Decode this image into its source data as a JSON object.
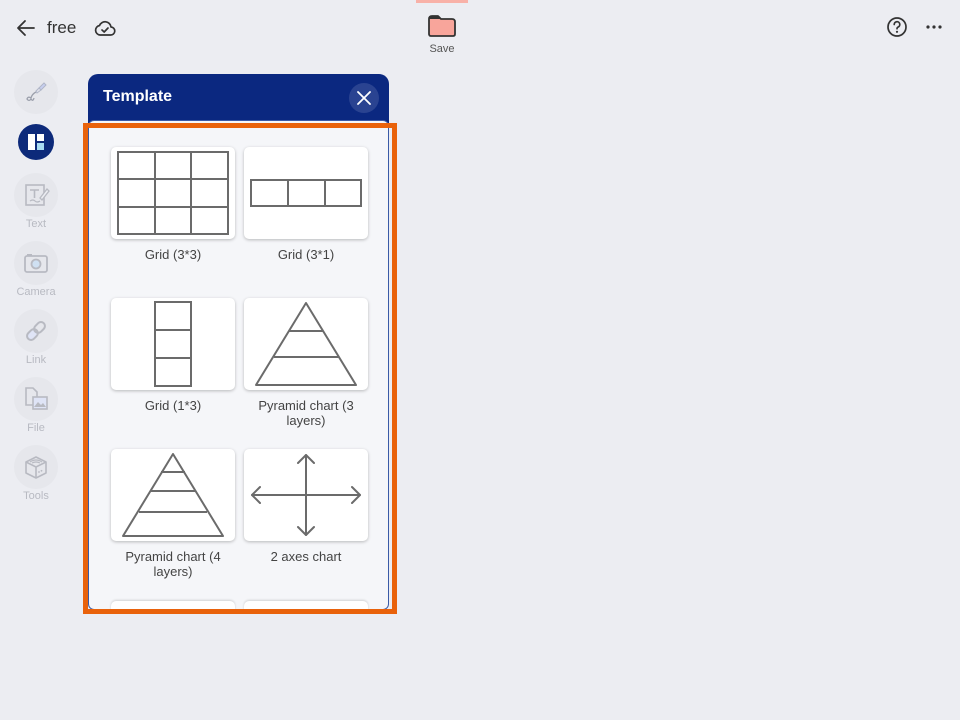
{
  "topbar": {
    "back_icon": "arrow-left-icon",
    "document_title": "free",
    "cloud_status_icon": "cloud-check-icon",
    "save": {
      "label": "Save",
      "icon": "folder-icon",
      "color": "#f8a59b"
    },
    "help_icon": "help-circle-icon",
    "more_icon": "more-horizontal-icon"
  },
  "toolbar": {
    "items": [
      {
        "id": "pen",
        "label": "",
        "icon": "pen-icon",
        "active": false
      },
      {
        "id": "template",
        "label": "",
        "icon": "template-icon",
        "active": true
      },
      {
        "id": "text",
        "label": "Text",
        "icon": "text-icon",
        "active": false
      },
      {
        "id": "camera",
        "label": "Camera",
        "icon": "camera-icon",
        "active": false
      },
      {
        "id": "link",
        "label": "Link",
        "icon": "link-icon",
        "active": false
      },
      {
        "id": "file",
        "label": "File",
        "icon": "file-image-icon",
        "active": false
      },
      {
        "id": "tools",
        "label": "Tools",
        "icon": "tools-box-icon",
        "active": false
      }
    ],
    "active_color": "#0d2a7a"
  },
  "template_panel": {
    "title": "Template",
    "close_icon": "close-icon",
    "header_color": "#0b2880",
    "highlight_color": "#e9620b",
    "templates": [
      {
        "label": "Grid (3*3)",
        "preview": "grid-3x3"
      },
      {
        "label": "Grid (3*1)",
        "preview": "grid-3x1"
      },
      {
        "label": "Grid (1*3)",
        "preview": "grid-1x3"
      },
      {
        "label": "Pyramid chart (3 layers)",
        "preview": "pyramid-3"
      },
      {
        "label": "Pyramid chart (4 layers)",
        "preview": "pyramid-4"
      },
      {
        "label": "2 axes chart",
        "preview": "two-axes"
      }
    ]
  }
}
